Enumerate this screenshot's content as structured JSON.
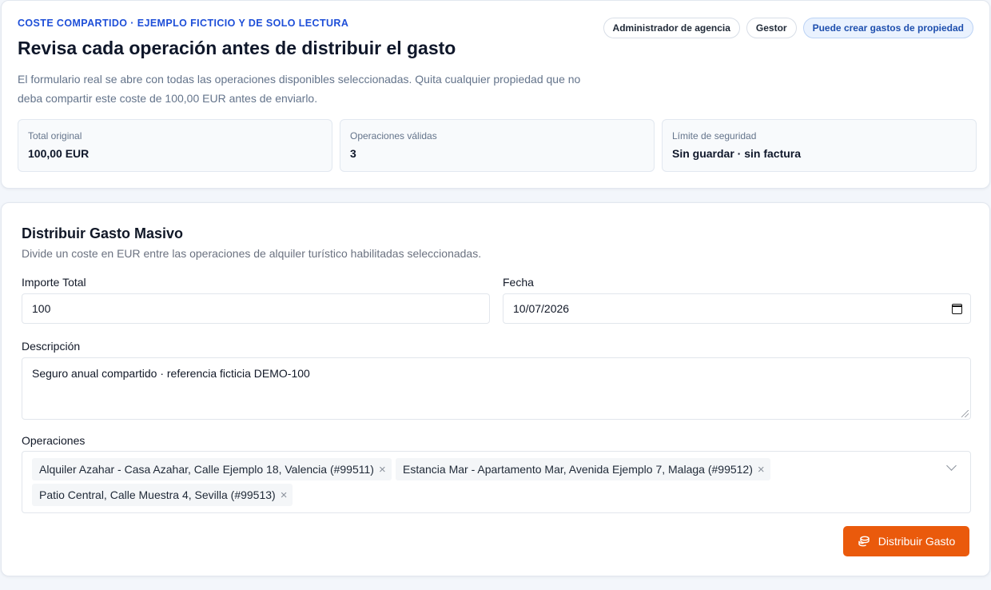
{
  "header": {
    "eyebrow": "COSTE COMPARTIDO · EJEMPLO FICTICIO Y DE SOLO LECTURA",
    "title": "Revisa cada operación antes de distribuir el gasto",
    "intro": "El formulario real se abre con todas las operaciones disponibles seleccionadas. Quita cualquier propiedad que no deba compartir este coste de 100,00 EUR antes de enviarlo.",
    "badges": [
      "Administrador de agencia",
      "Gestor",
      "Puede crear gastos de propiedad"
    ]
  },
  "stats": [
    {
      "label": "Total original",
      "value": "100,00 EUR"
    },
    {
      "label": "Operaciones válidas",
      "value": "3"
    },
    {
      "label": "Límite de seguridad",
      "value": "Sin guardar · sin factura"
    }
  ],
  "form": {
    "title": "Distribuir Gasto Masivo",
    "subtitle": "Divide un coste en EUR entre las operaciones de alquiler turístico habilitadas seleccionadas.",
    "amount_label": "Importe Total",
    "amount_value": "100",
    "date_label": "Fecha",
    "date_value": "10/07/2026",
    "description_label": "Descripción",
    "description_value": "Seguro anual compartido · referencia ficticia DEMO-100",
    "operations_label": "Operaciones",
    "operations": [
      "Alquiler Azahar - Casa Azahar, Calle Ejemplo 18, Valencia (#99511)",
      "Estancia Mar - Apartamento Mar, Avenida Ejemplo 7, Malaga (#99512)",
      "Patio Central, Calle Muestra 4, Sevilla (#99513)"
    ],
    "remove_glyph": "×",
    "submit_label": "Distribuir Gasto"
  },
  "colors": {
    "accent": "#1d4ed8",
    "submit": "#ea5a0c"
  },
  "icons": [
    "calendar-icon",
    "chevron-down-icon",
    "remove-icon",
    "coins-icon"
  ]
}
